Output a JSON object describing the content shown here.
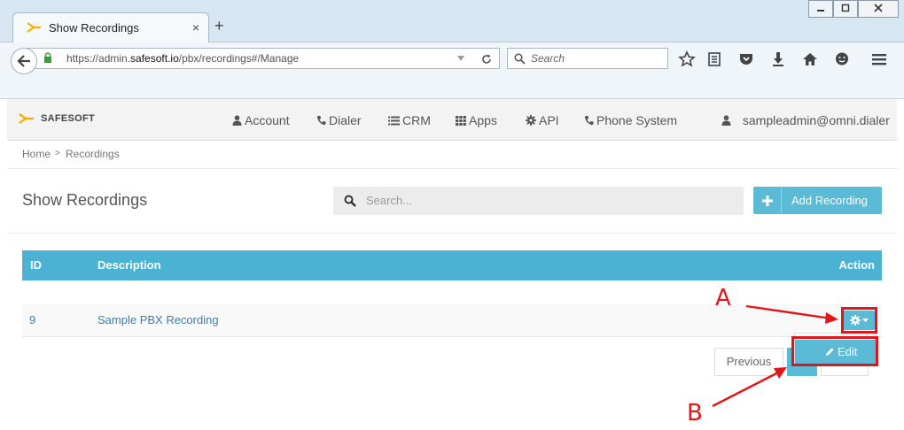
{
  "browser": {
    "tab_title": "Show Recordings",
    "tab_close": "×",
    "new_tab": "+",
    "url_prefix": "https://admin.",
    "url_domain": "safesoft.io",
    "url_path": "/pbx/recordings#/Manage",
    "search_placeholder": "Search",
    "window_minimize": "▭",
    "window_restore": "▢",
    "window_close": "✕"
  },
  "app": {
    "brand": "SAFESOFT",
    "nav": [
      {
        "label": "Account",
        "icon": "user-icon"
      },
      {
        "label": "Dialer",
        "icon": "phone-icon"
      },
      {
        "label": "CRM",
        "icon": "list-icon"
      },
      {
        "label": "Apps",
        "icon": "grid-icon"
      },
      {
        "label": "API",
        "icon": "gear-icon"
      },
      {
        "label": "Phone System",
        "icon": "phone-icon"
      }
    ],
    "user": "sampleadmin@omni.dialer"
  },
  "breadcrumb": {
    "home": "Home",
    "separator": ">",
    "current": "Recordings"
  },
  "page": {
    "title": "Show Recordings",
    "search_placeholder": "Search...",
    "add_button": "Add Recording"
  },
  "table": {
    "headers": {
      "id": "ID",
      "description": "Description",
      "action": "Action"
    },
    "rows": [
      {
        "id": "9",
        "description": "Sample PBX Recording"
      }
    ]
  },
  "dropdown": {
    "edit_label": "Edit"
  },
  "pagination": {
    "previous": "Previous"
  },
  "annotations": {
    "a": "A",
    "b": "B"
  },
  "colors": {
    "accent": "#5bbad5",
    "table_header": "#4bb2d3",
    "annotation": "#e0161b",
    "link": "#3a7fa8"
  }
}
